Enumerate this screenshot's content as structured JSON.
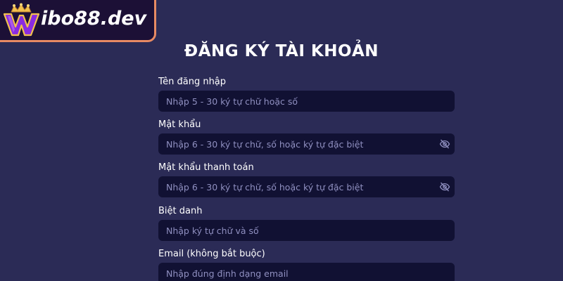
{
  "brand": {
    "logo_text": "ibo88.dev",
    "accent_color": "#e88a63"
  },
  "form": {
    "title": "ĐĂNG KÝ TÀI KHOẢN",
    "fields": [
      {
        "label": "Tên đăng nhập",
        "placeholder": "Nhập 5 - 30 ký tự chữ hoặc số",
        "has_toggle": false
      },
      {
        "label": "Mật khẩu",
        "placeholder": "Nhập 6 - 30 ký tự chữ, số hoặc ký tự đặc biệt",
        "has_toggle": true,
        "toggle_icon": "eye-off-icon"
      },
      {
        "label": "Mật khẩu thanh toán",
        "placeholder": "Nhập 6 - 30 ký tự chữ, số hoặc ký tự đặc biệt",
        "has_toggle": true,
        "toggle_icon": "eye-off-icon"
      },
      {
        "label": "Biệt danh",
        "placeholder": "Nhập ký tự chữ và số",
        "has_toggle": false
      },
      {
        "label": "Email (không bắt buộc)",
        "placeholder": "Nhập đúng định dạng email",
        "has_toggle": false
      }
    ]
  },
  "colors": {
    "background": "#2b2b56",
    "input_background": "#111133",
    "placeholder": "#8f8fc0"
  }
}
